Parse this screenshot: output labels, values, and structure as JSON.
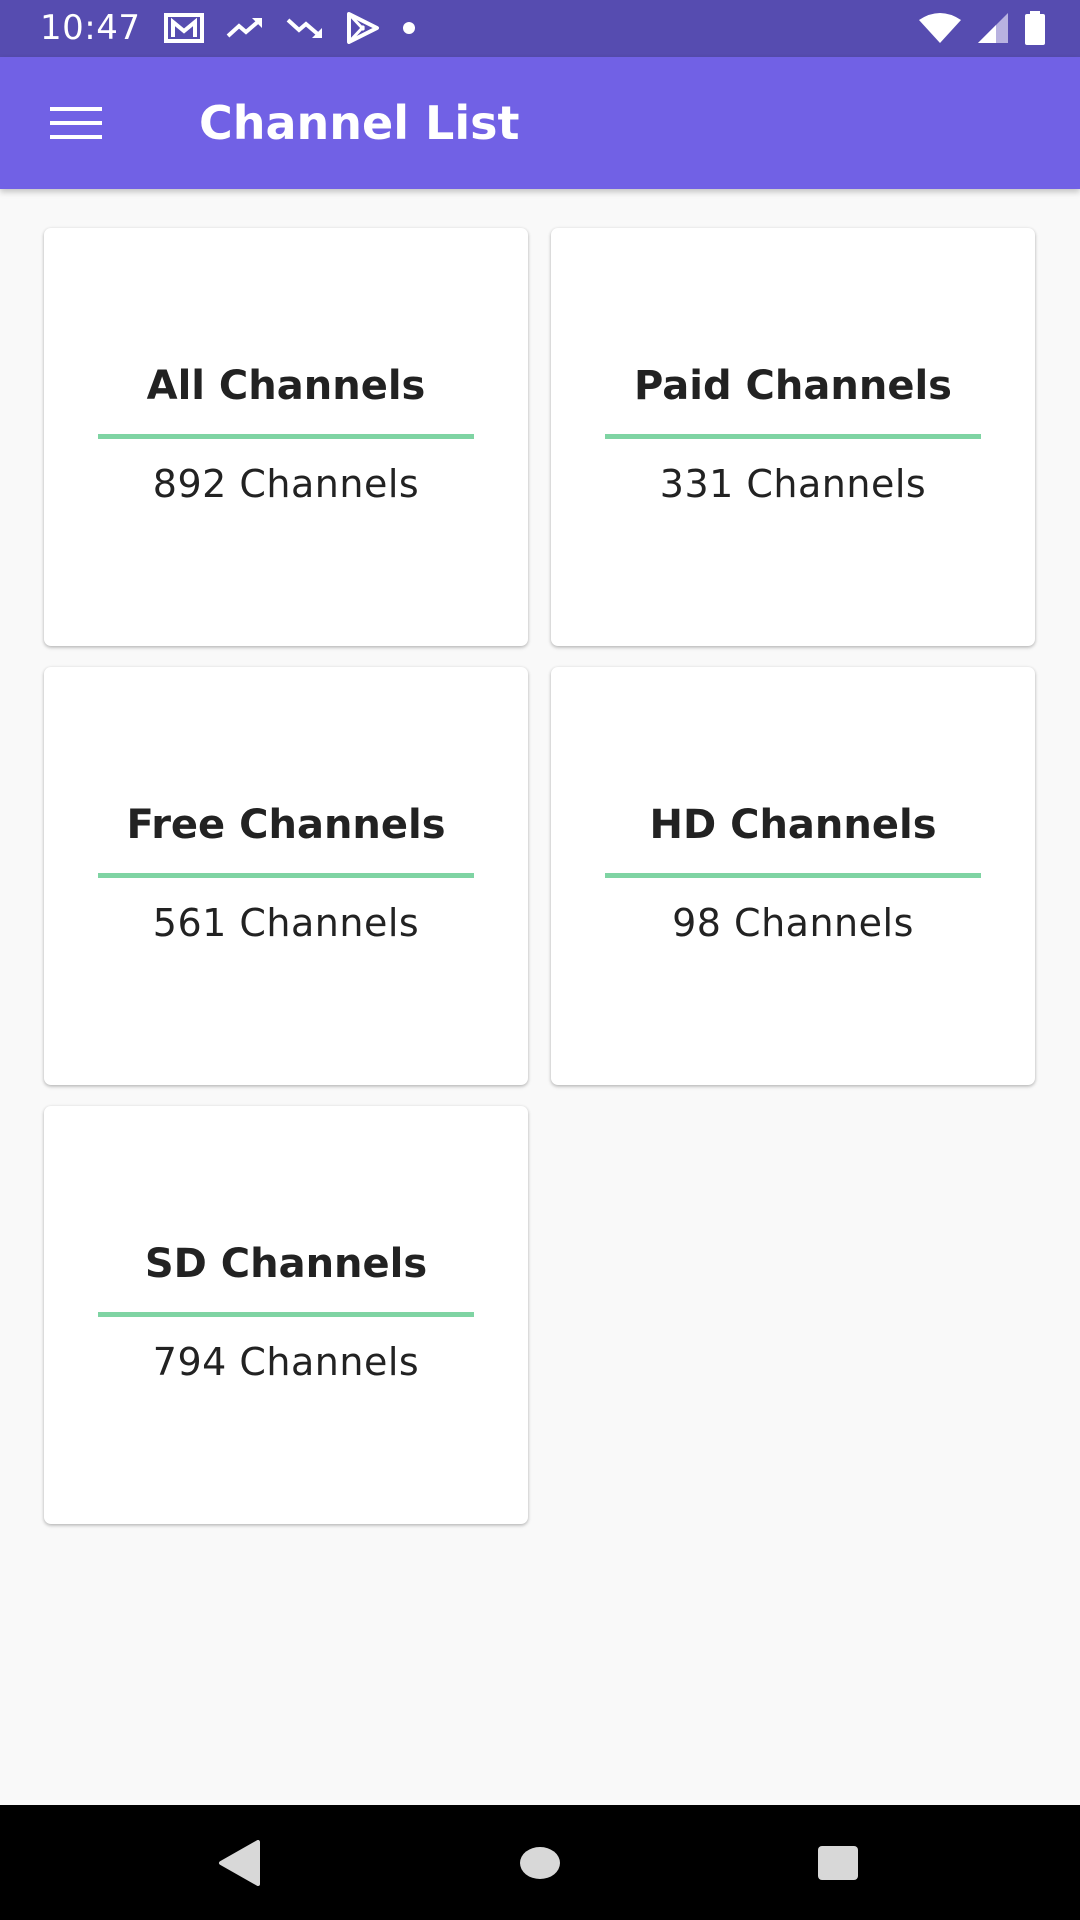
{
  "status_bar": {
    "time": "10:47",
    "icons_left": [
      "gmail-icon",
      "trending-up-icon",
      "trending-down-icon",
      "play-store-icon",
      "notification-dot-icon"
    ],
    "icons_right": [
      "wifi-icon",
      "cell-signal-icon",
      "battery-icon"
    ]
  },
  "app_bar": {
    "title": "Channel List",
    "menu_icon": "hamburger-menu-icon",
    "color": "#7161e5"
  },
  "cards": [
    {
      "title": "All Channels",
      "count": "892 Channels"
    },
    {
      "title": "Paid Channels",
      "count": "331 Channels"
    },
    {
      "title": "Free Channels",
      "count": "561 Channels"
    },
    {
      "title": "HD Channels",
      "count": "98 Channels"
    },
    {
      "title": "SD Channels",
      "count": "794 Channels"
    }
  ],
  "accent_color": "#7fd4a3",
  "nav_bar": {
    "buttons": [
      "back-icon",
      "home-icon",
      "recents-icon"
    ]
  }
}
